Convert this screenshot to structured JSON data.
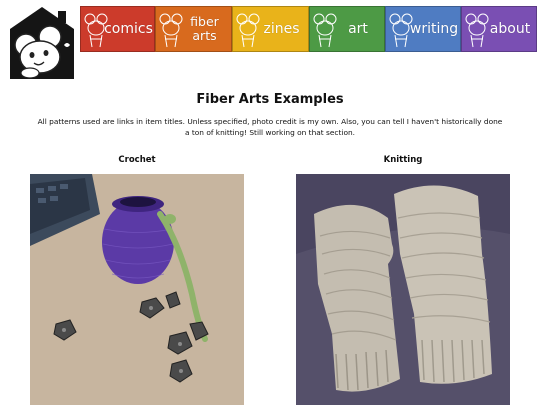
{
  "header": {
    "logo_icon": "cartoon-mouse-house-logo",
    "nav": [
      {
        "label": "comics",
        "color": "#cc3b2b"
      },
      {
        "label": "fiber arts",
        "color": "#d86a1e"
      },
      {
        "label": "zines",
        "color": "#e9b31a"
      },
      {
        "label": "art",
        "color": "#4d9a45"
      },
      {
        "label": "writing",
        "color": "#4f7cc2"
      },
      {
        "label": "about",
        "color": "#7a4fb3"
      }
    ]
  },
  "main": {
    "title": "Fiber Arts Examples",
    "intro": "All patterns used are links in item titles. Unless specified, photo credit is my own. Also, you can tell I haven't historically done a ton of knitting! Still working on that section.",
    "sections": [
      {
        "title": "Crochet",
        "photo_subject": "purple crocheted dice bag with green drawstring and metal dice"
      },
      {
        "title": "Knitting",
        "photo_subject": "gray knitted fingerless mitts"
      }
    ]
  }
}
